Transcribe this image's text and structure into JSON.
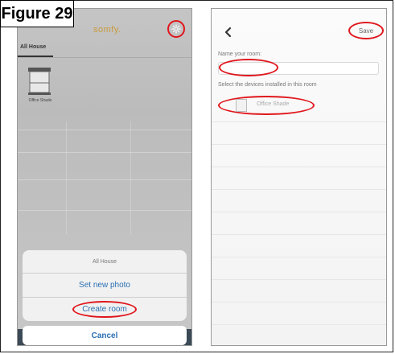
{
  "figure": {
    "label": "Figure 29"
  },
  "left_screen": {
    "logo": "somfy.",
    "tab": "All House",
    "device_tile": {
      "label": "Office Shade",
      "icon": "shade-icon"
    },
    "settings_icon": "gear-icon",
    "action_sheet": {
      "title": "All House",
      "options": [
        "Set new photo",
        "Create room"
      ],
      "cancel": "Cancel"
    }
  },
  "right_screen": {
    "back_icon": "chevron-left-icon",
    "save_label": "Save",
    "name_label": "Name your room:",
    "name_value": "",
    "devices_label": "Select the devices installed in this room",
    "devices": [
      {
        "name": "Office Shade",
        "icon": "shade-icon"
      }
    ]
  },
  "colors": {
    "highlight": "#e0161c",
    "link": "#2a6fb3",
    "brand": "#c99a3a"
  }
}
